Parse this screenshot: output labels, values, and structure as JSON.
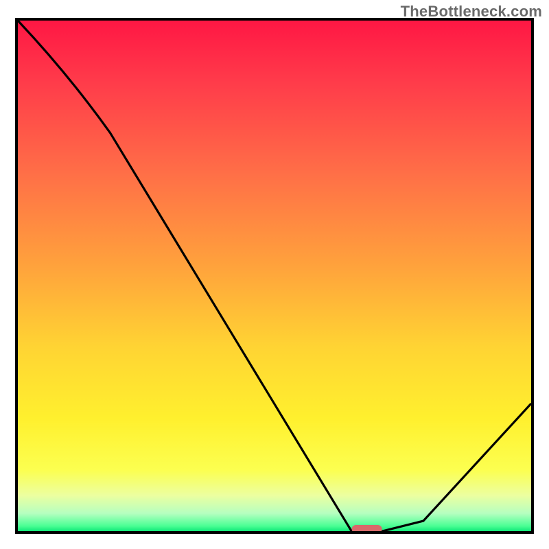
{
  "watermark": "TheBottleneck.com",
  "chart_data": {
    "type": "line",
    "title": "",
    "xlabel": "",
    "ylabel": "",
    "xlim": [
      0,
      100
    ],
    "ylim": [
      0,
      100
    ],
    "x": [
      0,
      18,
      65,
      71,
      79,
      100
    ],
    "values": [
      100,
      78,
      0,
      0,
      2,
      25
    ],
    "marker": {
      "x": 68,
      "y": 0,
      "color": "#d96a6a"
    },
    "background_gradient": {
      "stops": [
        {
          "offset": 0.0,
          "color": "#ff1744"
        },
        {
          "offset": 0.12,
          "color": "#ff3b4a"
        },
        {
          "offset": 0.3,
          "color": "#ff6f47"
        },
        {
          "offset": 0.48,
          "color": "#ffa23c"
        },
        {
          "offset": 0.64,
          "color": "#ffd433"
        },
        {
          "offset": 0.78,
          "color": "#fff02e"
        },
        {
          "offset": 0.88,
          "color": "#fcff50"
        },
        {
          "offset": 0.93,
          "color": "#ecffa0"
        },
        {
          "offset": 0.965,
          "color": "#b6ffc0"
        },
        {
          "offset": 0.99,
          "color": "#4aff94"
        },
        {
          "offset": 1.0,
          "color": "#10e878"
        }
      ]
    }
  }
}
